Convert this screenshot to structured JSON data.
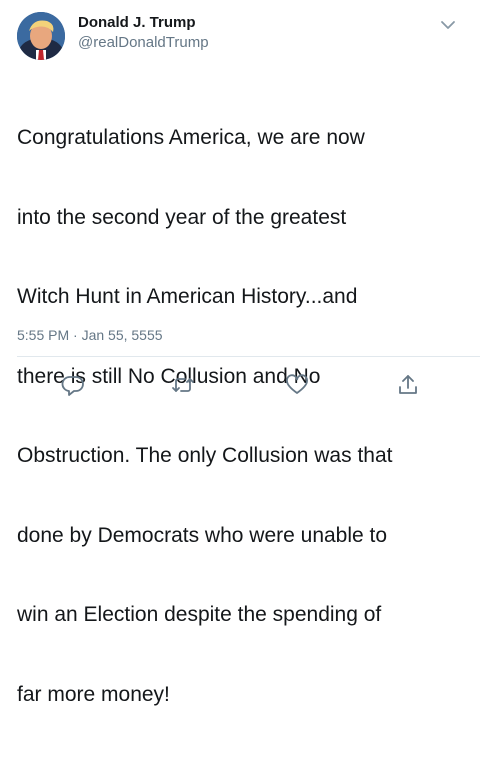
{
  "tweet": {
    "author": {
      "display_name": "Donald J. Trump",
      "handle": "@realDonaldTrump"
    },
    "lines": [
      "Congratulations America, we are now",
      "into the second year of the greatest",
      "Witch Hunt in American History...and",
      "there is still No Collusion and No",
      "Obstruction. The only Collusion was that",
      "done by Democrats who were unable to",
      "win an Election despite the spending of",
      "far more money!"
    ],
    "timestamp": "5:55 PM · Jan 55, 5555"
  },
  "icons": {
    "more": "chevron-down-icon",
    "reply": "reply-icon",
    "retweet": "retweet-icon",
    "like": "heart-icon",
    "share": "share-icon"
  },
  "colors": {
    "text": "#14171a",
    "secondary": "#657786",
    "divider": "#e1e8ed"
  }
}
